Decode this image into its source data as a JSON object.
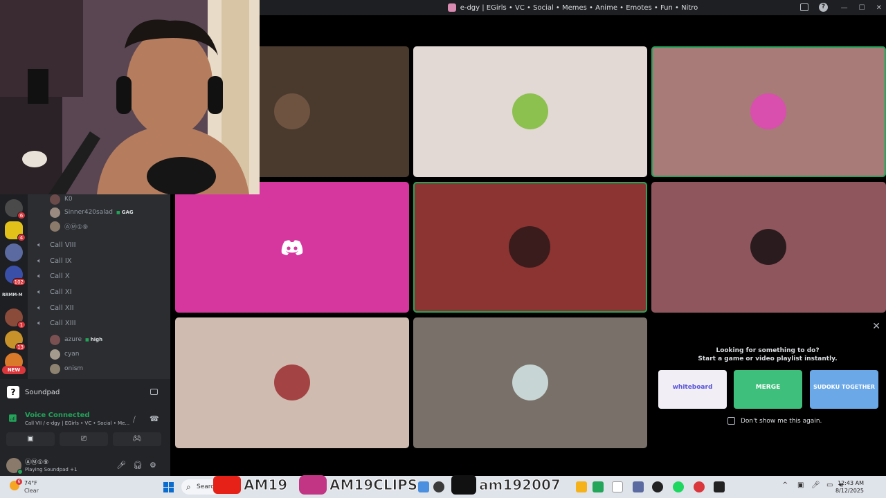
{
  "window": {
    "title": "e-dgy | EGirls • VC • Social • Memes • Anime • Emotes • Fun • Nitro"
  },
  "servers": {
    "badges": [
      "6",
      "4",
      "102",
      "1",
      "13"
    ],
    "label_text": "RRMM-M",
    "new_label": "NEW"
  },
  "channel_list": {
    "members_top": [
      {
        "name": "K0",
        "tag": ""
      },
      {
        "name": "Sinner420salad",
        "tag": "GAG"
      },
      {
        "name": "ⒶⓂ①⑨",
        "tag": ""
      }
    ],
    "voice_channels": [
      "Call VIII",
      "Call IX",
      "Call X",
      "Call XI",
      "Call XII",
      "Call XIII"
    ],
    "members_bottom": [
      {
        "name": "azure",
        "tag": "high"
      },
      {
        "name": "cyan",
        "tag": ""
      },
      {
        "name": "onism",
        "tag": ""
      }
    ]
  },
  "soundpad": {
    "label": "Soundpad"
  },
  "voice_panel": {
    "status": "Voice Connected",
    "location": "Call VII / e-dgy | EGirls • VC • Social • Me..."
  },
  "user_panel": {
    "name": "ⒶⓂ①⑨",
    "status": "Playing Soundpad +1"
  },
  "activity": {
    "line1": "Looking for something to do?",
    "line2": "Start a game or video playlist instantly.",
    "cards": [
      "whiteboard",
      "MERGE",
      "SUDOKU TOGETHER"
    ],
    "checkbox_label": "Don't show me this again."
  },
  "tiles": [
    {
      "bg": "#4a3a2e",
      "avatar": "#6e5340",
      "speaking": false
    },
    {
      "bg": "#e2d8d4",
      "avatar": "#8cc04f",
      "speaking": false
    },
    {
      "bg": "#a87a78",
      "avatar": "#d94fae",
      "speaking": true
    },
    {
      "bg": "#d5379f",
      "avatar": "",
      "speaking": false
    },
    {
      "bg": "#8b3431",
      "avatar": "#3a1c1c",
      "speaking": true
    },
    {
      "bg": "#8f565e",
      "avatar": "#2a1c1e",
      "speaking": false
    },
    {
      "bg": "#d0bbb0",
      "avatar": "#a34343",
      "speaking": false
    },
    {
      "bg": "#7a706a",
      "avatar": "#c7d6d4",
      "speaking": false
    }
  ],
  "overlay": {
    "handle1": "AM19",
    "handle2": "AM19CLIPS",
    "handle3": "am192007"
  },
  "taskbar": {
    "badge": "6",
    "temperature": "74°F",
    "condition": "Clear",
    "search": "Search",
    "time": "12:43 AM",
    "date": "8/12/2025"
  },
  "colors": {
    "accent": "#5865f2",
    "online": "#23a55a",
    "danger": "#da373c"
  }
}
